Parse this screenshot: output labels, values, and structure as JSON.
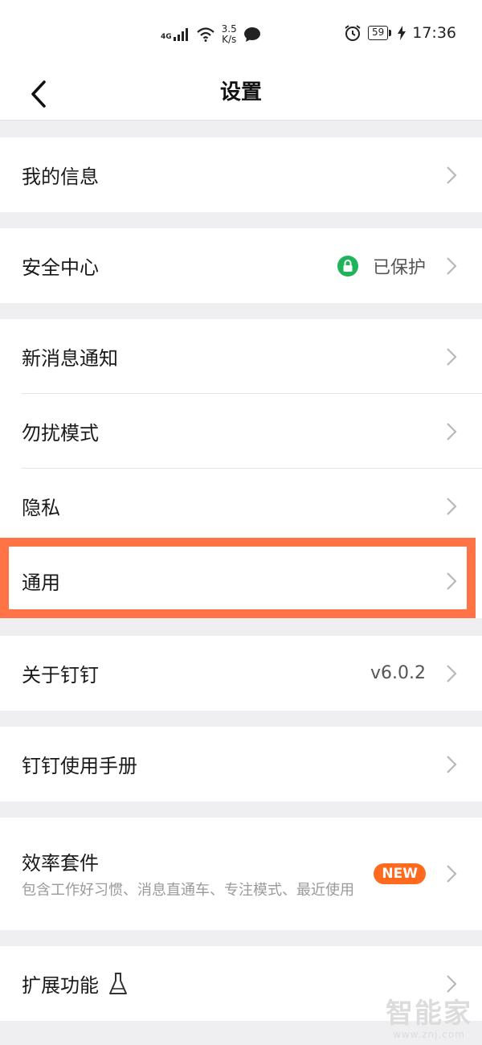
{
  "status_bar": {
    "network": "4G",
    "speed_value": "3.5",
    "speed_unit": "K/s",
    "battery": "59",
    "time": "17:36"
  },
  "nav": {
    "title": "设置"
  },
  "groups": {
    "my_info": {
      "label": "我的信息"
    },
    "security": {
      "label": "安全中心",
      "status": "已保护"
    },
    "notifications": {
      "label": "新消息通知"
    },
    "dnd": {
      "label": "勿扰模式"
    },
    "privacy": {
      "label": "隐私"
    },
    "general": {
      "label": "通用"
    },
    "about": {
      "label": "关于钉钉",
      "version": "v6.0.2"
    },
    "manual": {
      "label": "钉钉使用手册"
    },
    "efficiency": {
      "label": "效率套件",
      "desc": "包含工作好习惯、消息直通车、专注模式、最近使用",
      "badge": "NEW"
    },
    "extensions": {
      "label": "扩展功能"
    }
  },
  "watermark": {
    "brand": "智能家",
    "url": "www.znj.com"
  },
  "colors": {
    "highlight": "#ff7346",
    "secure_green": "#1fb45a",
    "new_badge": "#ff6a1f"
  }
}
